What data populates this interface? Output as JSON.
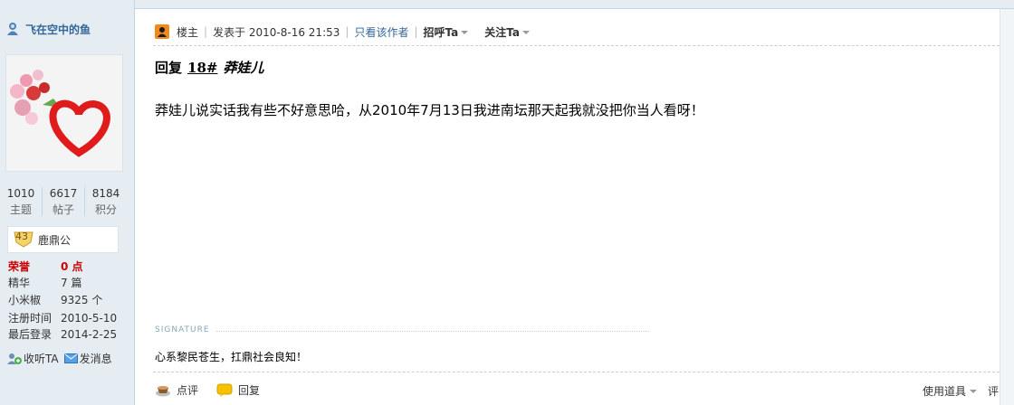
{
  "user": {
    "name": "飞在空中的鱼"
  },
  "stats": [
    {
      "value": "1010",
      "label": "主题"
    },
    {
      "value": "6617",
      "label": "帖子"
    },
    {
      "value": "8184",
      "label": "积分"
    }
  ],
  "rank": {
    "level": "43",
    "name": "鹿鼎公"
  },
  "profile": {
    "honor_k": "荣誉",
    "honor_v": "0 点",
    "elite_k": "精华",
    "elite_v": "7 篇",
    "pepper_k": "小米椒",
    "pepper_v": "9325 个",
    "reg_k": "注册时间",
    "reg_v": "2010-5-10",
    "last_k": "最后登录",
    "last_v": "2014-2-25"
  },
  "actions": {
    "follow": "收听TA",
    "message": "发消息"
  },
  "post": {
    "floor_label": "楼主",
    "posted": "发表于 2010-8-16 21:53",
    "only_author": "只看该作者",
    "greet": "招呼Ta",
    "follow": "关注Ta",
    "title_prefix": "回复",
    "title_floor": "18#",
    "title_user": "莽娃儿",
    "content": "莽娃儿说实话我有些不好意思哈，从2010年7月13日我进南坛那天起我就没把你当人看呀！",
    "signature_label": "SIGNATURE",
    "signature": "心系黎民苍生，扛鼎社会良知！"
  },
  "footer": {
    "comment": "点评",
    "reply": "回复",
    "tools": "使用道具",
    "rate": "评"
  },
  "colors": {
    "sidebar_bg": "#e5edf2",
    "link": "#336699",
    "honor_red": "#cc0000"
  }
}
